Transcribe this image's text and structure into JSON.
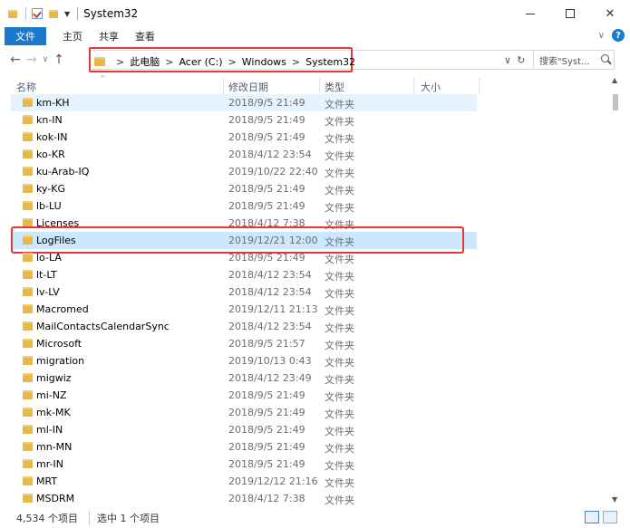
{
  "window": {
    "title": "System32",
    "controls": {
      "minimize": "—",
      "maximize": "☐",
      "close": "✕"
    }
  },
  "ribbon": {
    "file_tab": "文件",
    "tabs": [
      "主页",
      "共享",
      "查看"
    ],
    "help": "?"
  },
  "address": {
    "crumbs": [
      "此电脑",
      "Acer (C:)",
      "Windows",
      "System32"
    ],
    "separator": ">",
    "search_placeholder": "搜索\"Syst...",
    "dropdown": "∨",
    "refresh": "↻"
  },
  "columns": {
    "name": "名称",
    "date": "修改日期",
    "type": "类型",
    "size": "大小"
  },
  "rows": [
    {
      "name": "km-KH",
      "date": "2018/9/5 21:49",
      "type": "文件夹",
      "state": "hover"
    },
    {
      "name": "kn-IN",
      "date": "2018/9/5 21:49",
      "type": "文件夹"
    },
    {
      "name": "kok-IN",
      "date": "2018/9/5 21:49",
      "type": "文件夹"
    },
    {
      "name": "ko-KR",
      "date": "2018/4/12 23:54",
      "type": "文件夹"
    },
    {
      "name": "ku-Arab-IQ",
      "date": "2019/10/22 22:40",
      "type": "文件夹"
    },
    {
      "name": "ky-KG",
      "date": "2018/9/5 21:49",
      "type": "文件夹"
    },
    {
      "name": "lb-LU",
      "date": "2018/9/5 21:49",
      "type": "文件夹"
    },
    {
      "name": "Licenses",
      "date": "2018/4/12 7:38",
      "type": "文件夹"
    },
    {
      "name": "LogFiles",
      "date": "2019/12/21 12:00",
      "type": "文件夹",
      "state": "selected"
    },
    {
      "name": "lo-LA",
      "date": "2018/9/5 21:49",
      "type": "文件夹"
    },
    {
      "name": "lt-LT",
      "date": "2018/4/12 23:54",
      "type": "文件夹"
    },
    {
      "name": "lv-LV",
      "date": "2018/4/12 23:54",
      "type": "文件夹"
    },
    {
      "name": "Macromed",
      "date": "2019/12/11 21:13",
      "type": "文件夹"
    },
    {
      "name": "MailContactsCalendarSync",
      "date": "2018/4/12 23:54",
      "type": "文件夹"
    },
    {
      "name": "Microsoft",
      "date": "2018/9/5 21:57",
      "type": "文件夹"
    },
    {
      "name": "migration",
      "date": "2019/10/13 0:43",
      "type": "文件夹"
    },
    {
      "name": "migwiz",
      "date": "2018/4/12 23:49",
      "type": "文件夹"
    },
    {
      "name": "mi-NZ",
      "date": "2018/9/5 21:49",
      "type": "文件夹"
    },
    {
      "name": "mk-MK",
      "date": "2018/9/5 21:49",
      "type": "文件夹"
    },
    {
      "name": "ml-IN",
      "date": "2018/9/5 21:49",
      "type": "文件夹"
    },
    {
      "name": "mn-MN",
      "date": "2018/9/5 21:49",
      "type": "文件夹"
    },
    {
      "name": "mr-IN",
      "date": "2018/9/5 21:49",
      "type": "文件夹"
    },
    {
      "name": "MRT",
      "date": "2019/12/12 21:16",
      "type": "文件夹"
    },
    {
      "name": "MSDRM",
      "date": "2018/4/12 7:38",
      "type": "文件夹"
    }
  ],
  "status": {
    "count": "4,534 个项目",
    "selected": "选中 1 个项目"
  },
  "colors": {
    "accent": "#1979ca",
    "folder": "#e8b84a",
    "highlight_box": "#e53935",
    "selected_row": "#cce8ff",
    "hover_row": "#e5f3ff"
  }
}
